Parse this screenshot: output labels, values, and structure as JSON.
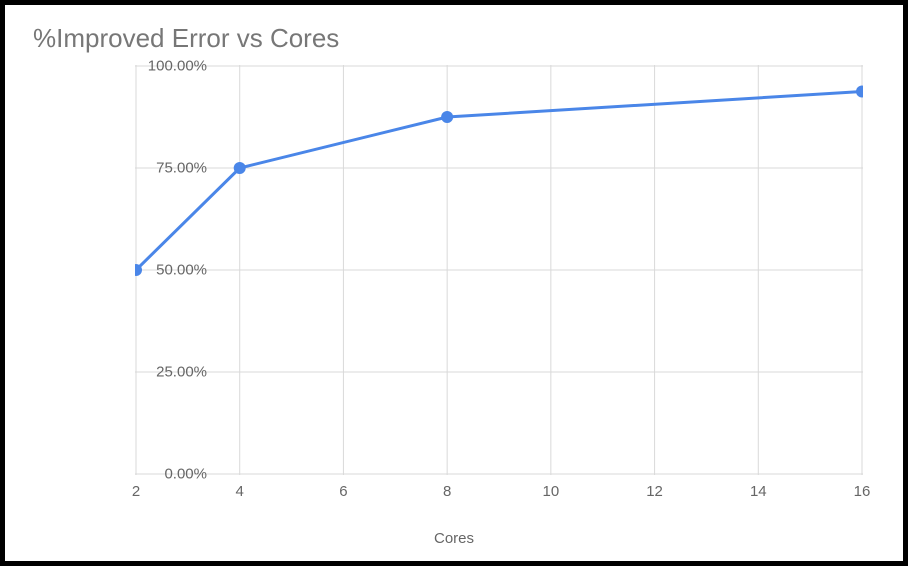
{
  "chart_data": {
    "type": "line",
    "title": "%Improved Error vs Cores",
    "xlabel": "Cores",
    "ylabel": "",
    "x_ticks": [
      "2",
      "4",
      "6",
      "8",
      "10",
      "12",
      "14",
      "16"
    ],
    "y_ticks": [
      "0.00%",
      "25.00%",
      "50.00%",
      "75.00%",
      "100.00%"
    ],
    "ylim": [
      0,
      100
    ],
    "x_positions": [
      2,
      4,
      6,
      8,
      10,
      12,
      14,
      16
    ],
    "series": [
      {
        "name": "%Improved Error",
        "x": [
          2,
          4,
          8,
          16
        ],
        "y": [
          50,
          75,
          87.5,
          93.75
        ]
      }
    ],
    "colors": {
      "line": "#4a86e8",
      "grid": "#d9d9d9",
      "text": "#666666"
    }
  }
}
